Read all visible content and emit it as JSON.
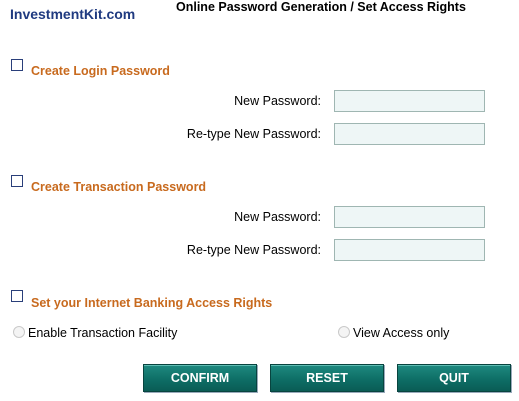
{
  "header": {
    "logo": "InvestmentKit.com",
    "title": "Online Password Generation / Set Access Rights"
  },
  "login_section": {
    "label": "Create Login Password",
    "new_password_label": "New Password:",
    "retype_password_label": "Re-type New Password:",
    "new_password_value": "",
    "retype_password_value": ""
  },
  "transaction_section": {
    "label": "Create Transaction Password",
    "new_password_label": "New Password:",
    "retype_password_label": "Re-type New Password:",
    "new_password_value": "",
    "retype_password_value": ""
  },
  "access_section": {
    "label": "Set your Internet Banking Access Rights",
    "options": [
      "Enable Transaction Facility",
      "View Access only"
    ]
  },
  "buttons": {
    "confirm": "CONFIRM",
    "reset": "RESET",
    "quit": "QUIT"
  }
}
